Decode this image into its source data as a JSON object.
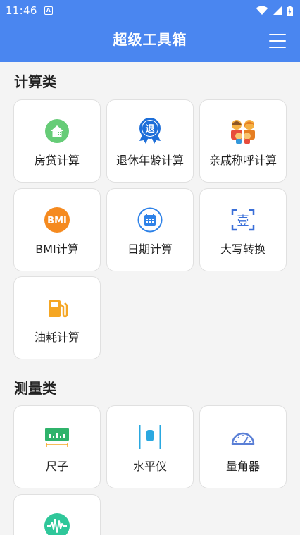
{
  "status_bar": {
    "time": "11:46"
  },
  "app_bar": {
    "title": "超级工具箱"
  },
  "sections": [
    {
      "title": "计算类",
      "tools": [
        {
          "label": "房贷计算",
          "icon": "house-icon"
        },
        {
          "label": "退休年龄计算",
          "icon": "retire-badge-icon",
          "badge_text": "退"
        },
        {
          "label": "亲戚称呼计算",
          "icon": "family-icon"
        },
        {
          "label": "BMI计算",
          "icon": "bmi-icon",
          "badge_text": "BMI"
        },
        {
          "label": "日期计算",
          "icon": "calendar-icon"
        },
        {
          "label": "大写转换",
          "icon": "uppercase-scan-icon",
          "badge_text": "壹"
        },
        {
          "label": "油耗计算",
          "icon": "fuel-pump-icon"
        }
      ]
    },
    {
      "title": "测量类",
      "tools": [
        {
          "label": "尺子",
          "icon": "ruler-icon"
        },
        {
          "label": "水平仪",
          "icon": "level-icon"
        },
        {
          "label": "量角器",
          "icon": "protractor-icon"
        },
        {
          "label": "",
          "icon": "sound-wave-icon"
        }
      ]
    }
  ],
  "colors": {
    "app_bar": "#4a86f0",
    "house": "#66cc77",
    "retire": "#1e6fd9",
    "bmi": "#f58a1f",
    "calendar": "#2e82e8",
    "uppercase": "#3a6fd8",
    "fuel": "#f5a623",
    "ruler": "#2fb36b",
    "level": "#2aa8e0",
    "protractor": "#5a7fd6",
    "wave": "#2fc79a"
  }
}
